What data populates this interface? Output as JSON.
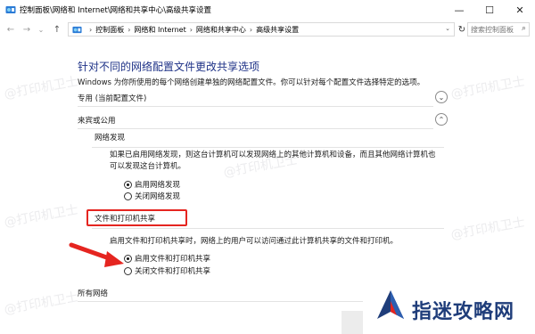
{
  "window": {
    "title": "控制面板\\网络和 Internet\\网络和共享中心\\高级共享设置",
    "minimize_glyph": "—",
    "maximize_glyph": "☐",
    "close_glyph": "✕"
  },
  "address_bar": {
    "back_glyph": "←",
    "forward_glyph": "→",
    "recent_glyph": "⌄",
    "up_glyph": "↑",
    "breadcrumb": [
      "控制面板",
      "网络和 Internet",
      "网络和共享中心",
      "高级共享设置"
    ],
    "breadcrumb_sep": "›",
    "dropdown_glyph": "⌄",
    "refresh_glyph": "↻",
    "search_placeholder": "搜索控制面板",
    "search_glyph": "⌕"
  },
  "page": {
    "heading": "针对不同的网络配置文件更改共享选项",
    "description": "Windows 为你所使用的每个网络创建单独的网络配置文件。你可以针对每个配置文件选择特定的选项。"
  },
  "profiles": [
    {
      "label": "专用 (当前配置文件)",
      "expanded": false,
      "toggle_glyph": "⌄"
    },
    {
      "label": "来宾或公用",
      "expanded": true,
      "toggle_glyph": "⌃"
    },
    {
      "label": "所有网络",
      "expanded": false,
      "toggle_glyph": "⌄"
    }
  ],
  "network_discovery": {
    "title": "网络发现",
    "text_line1": "如果已启用网络发现，则这台计算机可以发现网络上的其他计算机和设备，而且其他网络计算机也",
    "text_line2": "可以发现这台计算机。",
    "options": [
      {
        "label": "启用网络发现",
        "selected": true
      },
      {
        "label": "关闭网络发现",
        "selected": false
      }
    ]
  },
  "file_printer_sharing": {
    "title": "文件和打印机共享",
    "text": "启用文件和打印机共享时，网络上的用户可以访问通过此计算机共享的文件和打印机。",
    "options": [
      {
        "label": "启用文件和打印机共享",
        "selected": true
      },
      {
        "label": "关闭文件和打印机共享",
        "selected": false
      }
    ]
  },
  "annotation": {
    "highlight_color": "#e52520"
  },
  "watermark": {
    "text": "@打印机卫士"
  },
  "logo": {
    "text": "指迷攻略网"
  },
  "colors": {
    "heading": "#1e3287",
    "accent_red": "#e52520"
  }
}
